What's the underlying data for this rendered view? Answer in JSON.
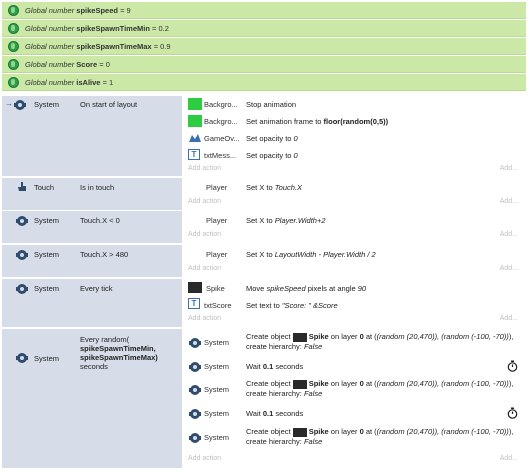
{
  "globals": [
    {
      "prefix": "Global number",
      "name": "spikeSpeed",
      "value": "= 9"
    },
    {
      "prefix": "Global number",
      "name": "spikeSpawnTimeMin",
      "value": "= 0.2"
    },
    {
      "prefix": "Global number",
      "name": "spikeSpawnTimeMax",
      "value": "= 0.9"
    },
    {
      "prefix": "Global number",
      "name": "Score",
      "value": "= 0"
    },
    {
      "prefix": "Global number",
      "name": "isAlive",
      "value": "= 1"
    }
  ],
  "add_action_label": "Add action",
  "add_label": "Add...",
  "events": {
    "e1": {
      "object": "System",
      "condition": "On start of layout",
      "actions": [
        {
          "object": "Backgro...",
          "text": "Stop animation"
        },
        {
          "object": "Backgro...",
          "text_a": "Set animation frame to ",
          "text_b": "floor(random(0,5))"
        },
        {
          "object": "GameOv...",
          "text_a": "Set opacity to ",
          "text_b": "0"
        },
        {
          "object": "txtMess...",
          "text_a": "Set opacity to ",
          "text_b": "0"
        }
      ]
    },
    "e2": {
      "object": "Touch",
      "condition": "Is in touch",
      "act_object": "Player",
      "act_a": "Set X to ",
      "act_b": "Touch.X"
    },
    "e3": {
      "object": "System",
      "condition": "Touch.X < 0",
      "act_object": "Player",
      "act_a": "Set X to ",
      "act_b": "Player.Width+2"
    },
    "e4": {
      "object": "System",
      "condition": "Touch.X > 480",
      "act_object": "Player",
      "act_a": "Set X to ",
      "act_b": "LayoutWidth - Player.Width / 2"
    },
    "e5": {
      "object": "System",
      "condition": "Every tick",
      "a1_object": "Spike",
      "a1_pre": "Move ",
      "a1_var": "spikeSpeed",
      "a1_post": " pixels at angle ",
      "a1_angle": "90",
      "a2_object": "txtScore",
      "a2_pre": "Set text to ",
      "a2_val": "\"Score: \" &Score"
    },
    "e6": {
      "object": "System",
      "cond_line1": "Every random(",
      "cond_line2": "spikeSpawnTimeMin,",
      "cond_line3": "spikeSpawnTimeMax)",
      "cond_line4": "seconds",
      "actions": [
        {
          "object": "System",
          "pre": "Create object ",
          "spike": "Spike",
          "mid": " on layer ",
          "layer": "0",
          "at": " at (",
          "expr": "(random (20,470)), (random (-100, -70))",
          "end": "), create hierarchy: ",
          "h": "False"
        },
        {
          "object": "System",
          "wait": "Wait ",
          "secs": "0.1",
          "unit": " seconds"
        },
        {
          "object": "System",
          "pre": "Create object ",
          "spike": "Spike",
          "mid": " on layer ",
          "layer": "0",
          "at": " at (",
          "expr": "(random (20,470)), (random (-100, -70))",
          "end": "), create hierarchy: ",
          "h": "False"
        },
        {
          "object": "System",
          "wait": "Wait ",
          "secs": "0.1",
          "unit": " seconds"
        },
        {
          "object": "System",
          "pre": "Create object ",
          "spike": "Spike",
          "mid": " on layer ",
          "layer": "0",
          "at": " at (",
          "expr": "(random (20,470)), (random (-100, -70))",
          "end": "), create hierarchy: ",
          "h": "False"
        }
      ]
    }
  },
  "colors": {
    "global_bg": "#cbe8a6",
    "condition_bg": "#d6dde8",
    "system_icon": "#2f4b6e",
    "globe": "#2e9e4a",
    "bg_sprite": "#2ecc40",
    "spike": "#2a2a2a"
  }
}
